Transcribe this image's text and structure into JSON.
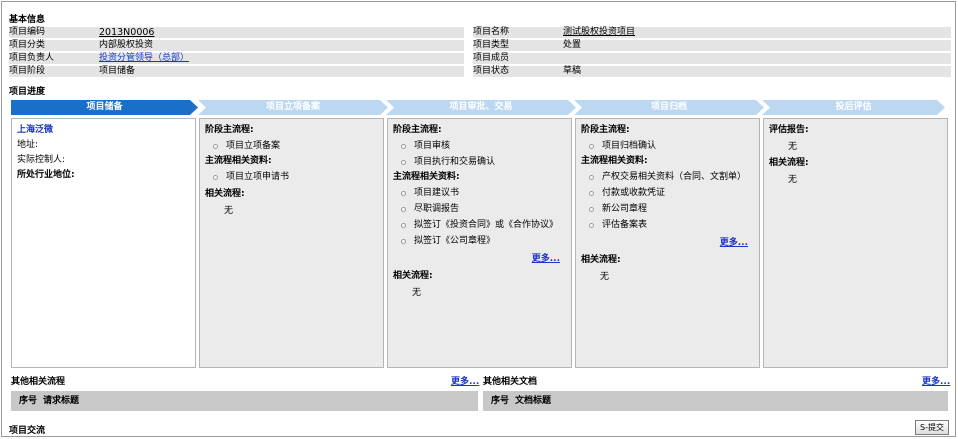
{
  "basic_info": {
    "title": "基本信息",
    "rows": [
      {
        "l1": "项目编码",
        "v1": "2013N0006",
        "l2": "项目名称",
        "v2": "测试股权投资项目"
      },
      {
        "l1": "项目分类",
        "v1": "内部股权投资",
        "l2": "项目类型",
        "v2": "处置"
      },
      {
        "l1": "项目负责人",
        "v1": "投资分管领导（总部）",
        "l2": "项目成员",
        "v2": ""
      },
      {
        "l1": "项目阶段",
        "v1": "项目储备",
        "l2": "项目状态",
        "v2": "草稿"
      }
    ]
  },
  "progress": {
    "title": "项目进度",
    "steps": [
      "项目储备",
      "项目立项备案",
      "项目审批、交易",
      "项目归档",
      "投后评估"
    ]
  },
  "columns": {
    "c1": {
      "company": "上海泛微",
      "address": "地址:",
      "controller": "实际控制人:",
      "industry": "所处行业地位:"
    },
    "c2": {
      "main_flow": "阶段主流程:",
      "flow_items": [
        "项目立项备案"
      ],
      "docs_title": "主流程相关资料:",
      "doc_items": [
        "项目立项申请书"
      ],
      "related_title": "相关流程:",
      "related_value": "无"
    },
    "c3": {
      "main_flow": "阶段主流程:",
      "flow_items": [
        "项目审核",
        "项目执行和交易确认"
      ],
      "docs_title": "主流程相关资料:",
      "doc_items": [
        "项目建议书",
        "尽职调报告",
        "拟签订《投资合同》或《合作协议》",
        "拟签订《公司章程》"
      ],
      "more": "更多...",
      "related_title": "相关流程:",
      "related_value": "无"
    },
    "c4": {
      "main_flow": "阶段主流程:",
      "flow_items": [
        "项目归档确认"
      ],
      "docs_title": "主流程相关资料:",
      "doc_items": [
        "产权交易相关资料（合同、文割单）",
        "付款或收款凭证",
        "新公司章程",
        "评估备案表"
      ],
      "more": "更多...",
      "related_title": "相关流程:",
      "related_value": "无"
    },
    "c5": {
      "report_title": "评估报告:",
      "report_value": "无",
      "related_title": "相关流程:",
      "related_value": "无"
    }
  },
  "other_flows": {
    "title": "其他相关流程",
    "more": "更多...",
    "col_no": "序号",
    "col_title": "请求标题"
  },
  "other_docs": {
    "title": "其他相关文档",
    "more": "更多...",
    "col_no": "序号",
    "col_title": "文档标题"
  },
  "communication": {
    "title": "项目交流",
    "submit": "S-提交"
  }
}
